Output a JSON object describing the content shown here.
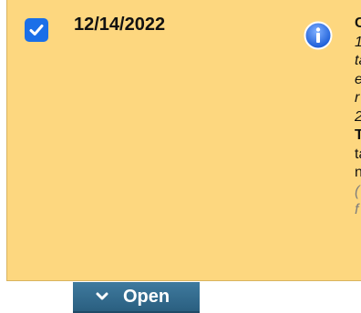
{
  "card": {
    "checked": true,
    "date": "12/14/2022",
    "info_icon": "info-icon",
    "right_lines": [
      {
        "text": "C",
        "style": "bold"
      },
      {
        "text": "1",
        "style": "italic"
      },
      {
        "text": "ta",
        "style": "italic"
      },
      {
        "text": "e",
        "style": "italic"
      },
      {
        "text": "r",
        "style": "italic"
      },
      {
        "text": "2",
        "style": "italic"
      },
      {
        "text": "T",
        "style": "bold"
      },
      {
        "text": "ta",
        "style": "normal"
      },
      {
        "text": "n",
        "style": "normal"
      },
      {
        "text": "(",
        "style": "gray-italic"
      },
      {
        "text": "f",
        "style": "gray-italic"
      }
    ]
  },
  "open_button": {
    "label": "Open",
    "icon": "chevron-down-icon"
  },
  "colors": {
    "card_bg": "#fdd77f",
    "checkbox": "#1a6fe8",
    "info": "#2f6fe0",
    "button_bg": "#2f6b8f"
  }
}
